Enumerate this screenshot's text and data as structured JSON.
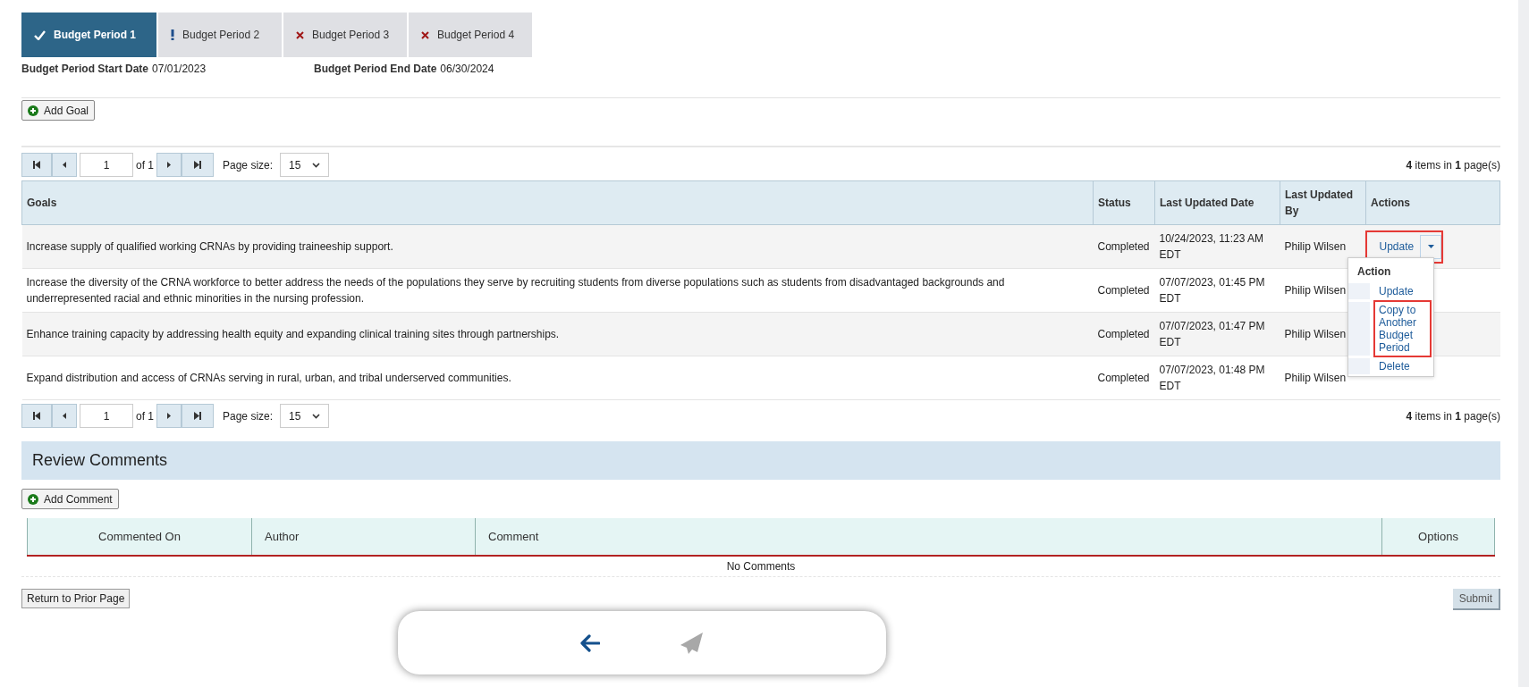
{
  "tabs": [
    {
      "label": "Budget Period 1",
      "selected": true,
      "kind": "complete"
    },
    {
      "label": "Budget Period 2",
      "selected": false,
      "kind": "warning"
    },
    {
      "label": "Budget Period 3",
      "selected": false,
      "kind": "error"
    },
    {
      "label": "Budget Period 4",
      "selected": false,
      "kind": "error"
    }
  ],
  "period": {
    "start_label": "Budget Period Start Date",
    "start": "07/01/2023",
    "end_label": "Budget Period End Date",
    "end": "06/30/2024"
  },
  "add_goal": "Add Goal",
  "pagers": [
    {
      "page": "1",
      "of": "of 1",
      "page_size_label": "Page size:",
      "page_size": "15",
      "summary": "**4** items in **1** page(s)"
    },
    {
      "page": "1",
      "of": "of 1",
      "page_size_label": "Page size:",
      "page_size": "15",
      "summary": "**4** items in **1** page(s)"
    }
  ],
  "table": {
    "columns": [
      "Goals",
      "Status",
      "Last Updated Date",
      "Last Updated By",
      "Actions"
    ],
    "rows": [
      {
        "goal": "Increase supply of qualified working CRNAs by providing traineeship support.",
        "status": "Completed",
        "date": "10/24/2023, 11:23 AM EDT",
        "by": "Philip Wilsen",
        "action": "Update",
        "highlighted": true
      },
      {
        "goal": "Increase the diversity of the CRNA workforce to better address the needs of the populations they serve by recruiting students from diverse populations such as students from disadvantaged backgrounds and underrepresented racial and ethnic minorities in the nursing profession.",
        "status": "Completed",
        "date": "07/07/2023, 01:45 PM EDT",
        "by": "Philip Wilsen"
      },
      {
        "goal": "Enhance training capacity by addressing health equity and expanding clinical training sites through partnerships.",
        "status": "Completed",
        "date": "07/07/2023, 01:47 PM EDT",
        "by": "Philip Wilsen"
      },
      {
        "goal": "Expand distribution and access of CRNAs serving in rural, urban, and tribal underserved communities.",
        "status": "Completed",
        "date": "07/07/2023, 01:48 PM EDT",
        "by": "Philip Wilsen"
      }
    ]
  },
  "action_menu": {
    "title": "Action",
    "items": [
      {
        "label": "Update",
        "highlighted": false
      },
      {
        "label": "Copy to Another Budget Period",
        "highlighted": true
      },
      {
        "label": "Delete",
        "highlighted": false
      }
    ]
  },
  "review": {
    "title": "Review Comments",
    "add_comment": "Add Comment",
    "columns": [
      "Commented On",
      "Author",
      "Comment",
      "Options"
    ],
    "empty": "No Comments"
  },
  "footer": {
    "return": "Return to Prior Page",
    "submit": "Submit"
  }
}
